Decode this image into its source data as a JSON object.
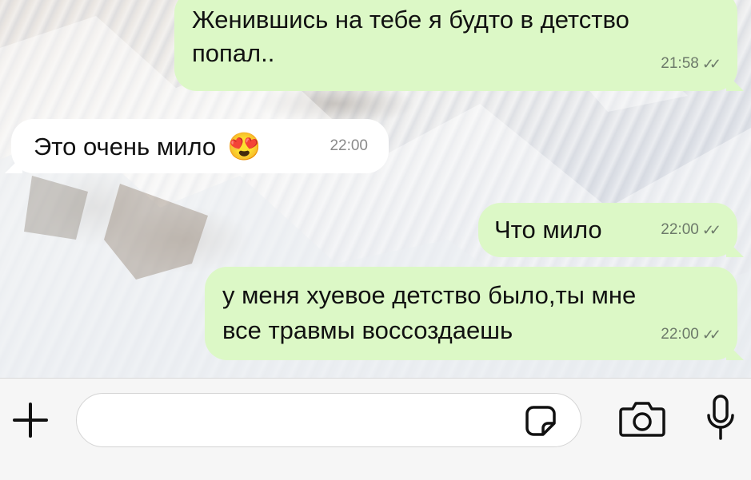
{
  "messages": [
    {
      "direction": "outgoing",
      "lines": [
        "Женившись на тебе я будто в детство",
        "попал.."
      ],
      "time": "21:58",
      "status": "read"
    },
    {
      "direction": "incoming",
      "text": "Это очень мило",
      "emoji": "😍",
      "time": "22:00"
    },
    {
      "direction": "outgoing",
      "text": "Что мило",
      "time": "22:00",
      "status": "read"
    },
    {
      "direction": "outgoing",
      "lines": [
        "у меня хуевое детство было,ты мне",
        "все травмы воссоздаешь"
      ],
      "time": "22:00",
      "status": "read"
    }
  ],
  "composer": {
    "placeholder": "",
    "icons": [
      "plus-icon",
      "sticker-icon",
      "camera-icon",
      "microphone-icon"
    ]
  },
  "colors": {
    "outgoing_bubble": "#dcf8c6",
    "incoming_bubble": "#ffffff",
    "icons": "#111111"
  }
}
